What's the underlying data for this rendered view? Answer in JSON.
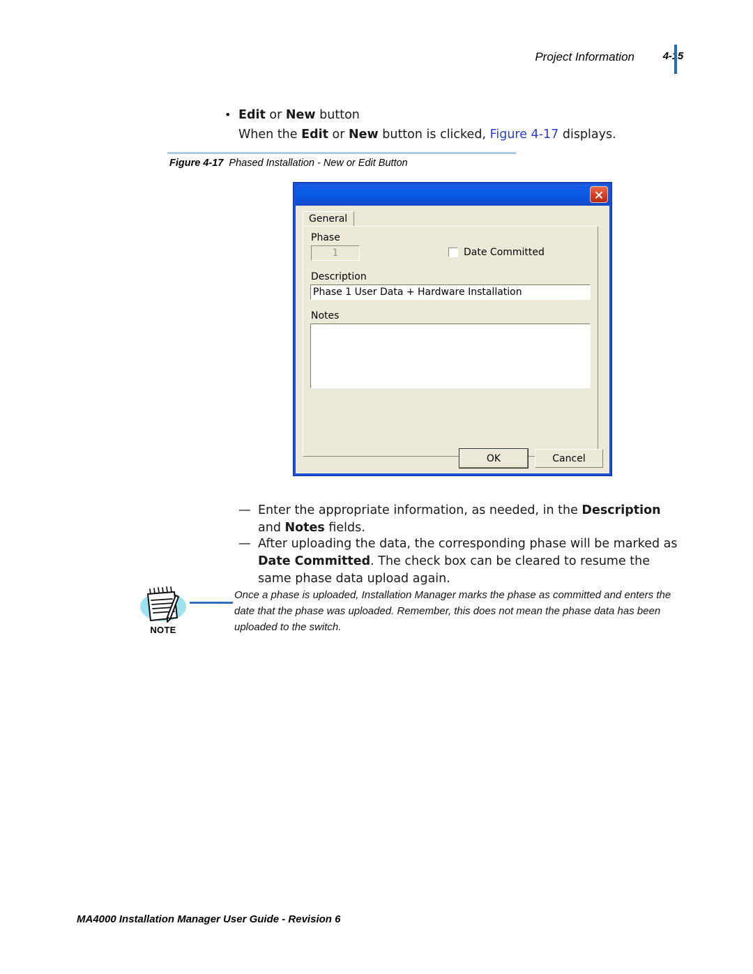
{
  "header": {
    "title": "Project Information",
    "page_number": "4-15"
  },
  "content": {
    "bullet": {
      "marker": "•",
      "bold_1": "Edit",
      "mid": " or ",
      "bold_2": "New",
      "tail": " button"
    },
    "subline": {
      "pre": "When the ",
      "bold_1": "Edit",
      "mid": " or ",
      "bold_2": "New",
      "mid_2": " button is clicked, ",
      "link": "Figure 4-17",
      "tail": " displays."
    },
    "figure_caption": {
      "number": "Figure 4-17",
      "text": "Phased Installation - New or Edit Button"
    },
    "dash_items": [
      {
        "marker": "—",
        "parts": [
          {
            "t": "Enter the appropriate information, as needed, in the ",
            "b": false
          },
          {
            "t": "Description",
            "b": true
          },
          {
            "t": " and ",
            "b": false
          },
          {
            "t": "Notes",
            "b": true
          },
          {
            "t": " fields.",
            "b": false
          }
        ]
      },
      {
        "marker": "—",
        "parts": [
          {
            "t": "After uploading the data, the corresponding phase will be marked as ",
            "b": false
          },
          {
            "t": "Date Committed",
            "b": true
          },
          {
            "t": ". The check box can be cleared to resume the same phase data upload again.",
            "b": false
          }
        ]
      }
    ],
    "note": {
      "label": "NOTE",
      "text": "Once a phase is uploaded, Installation Manager marks the phase as committed and enters the date that the phase was uploaded. Remember, this does not mean the phase data has been uploaded to the switch."
    }
  },
  "dialog": {
    "title": "",
    "close_icon": "close-icon",
    "tabs": [
      {
        "label": "General",
        "selected": true
      }
    ],
    "fields": {
      "phase_label": "Phase",
      "phase_value": "1",
      "phase_disabled": true,
      "date_committed_label": "Date Committed",
      "date_committed_checked": false,
      "description_label": "Description",
      "description_value": "Phase 1 User Data + Hardware Installation",
      "notes_label": "Notes",
      "notes_value": ""
    },
    "buttons": {
      "ok": "OK",
      "cancel": "Cancel"
    }
  },
  "footer": {
    "text": "MA4000 Installation Manager User Guide - Revision 6"
  },
  "colors": {
    "link": "#2a3ec8",
    "header_bar": "#1a6fc4",
    "figure_rule": "#a8cce4",
    "dialog_frame": "#1b4fd8",
    "dialog_face": "#ece9d8",
    "close_button": "#d7442b",
    "note_blob": "#9fe2ef",
    "note_connector": "#2e6fb8"
  }
}
